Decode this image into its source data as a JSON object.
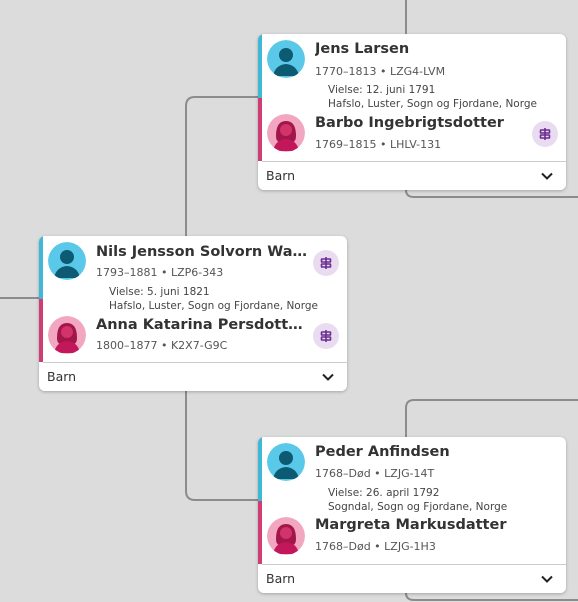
{
  "couples": [
    {
      "husband": {
        "name": "Jens Larsen",
        "meta": "1770–1813 • LZG4-LVM"
      },
      "marriage": {
        "date": "Vielse: 12. juni 1791",
        "place": "Hafslo, Luster, Sogn og Fjordane, Norge"
      },
      "wife": {
        "name": "Barbo Ingebrigtsdotter",
        "meta": "1769–1815 • LHLV-131"
      },
      "children_label": "Barn"
    },
    {
      "husband": {
        "name": "Nils Jensson Solvorn Walaker",
        "meta": "1793–1881 • LZP6-343"
      },
      "marriage": {
        "date": "Vielse: 5. juni 1821",
        "place": "Hafslo, Luster, Sogn og Fjordane, Norge"
      },
      "wife": {
        "name": "Anna Katarina Persdotter O...",
        "meta": "1800–1877 • K2X7-G9C"
      },
      "children_label": "Barn"
    },
    {
      "husband": {
        "name": "Peder Anfindsen",
        "meta": "1768–Død • LZJG-14T"
      },
      "marriage": {
        "date": "Vielse: 26. april 1792",
        "place": "Sogndal, Sogn og Fjordane, Norge"
      },
      "wife": {
        "name": "Margreta Markusdatter",
        "meta": "1768–Død • LZJG-1H3"
      },
      "children_label": "Barn"
    }
  ],
  "colors": {
    "background": "#dcdcdc",
    "male_accent": "#3fb8d6",
    "female_accent": "#cf3d74",
    "pedigree_button_bg": "#e9dcf1",
    "line": "#8c8c8c"
  },
  "icons": {
    "male_avatar": "male-avatar-icon",
    "female_avatar": "female-avatar-icon",
    "pedigree": "pedigree-icon",
    "expand": "chevron-down-icon"
  }
}
